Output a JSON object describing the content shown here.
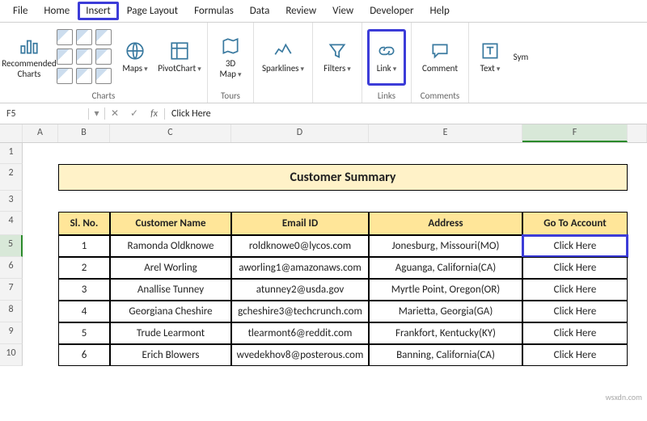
{
  "tabs": {
    "file": "File",
    "home": "Home",
    "insert": "Insert",
    "page_layout": "Page Layout",
    "formulas": "Formulas",
    "data": "Data",
    "review": "Review",
    "view": "View",
    "developer": "Developer",
    "help": "Help"
  },
  "ribbon": {
    "recommended_charts": "Recommended\nCharts",
    "charts_group": "Charts",
    "maps": "Maps",
    "pivotchart": "PivotChart",
    "threed_map": "3D\nMap",
    "tours_group": "Tours",
    "sparklines": "Sparklines",
    "filters": "Filters",
    "link": "Link",
    "links_group": "Links",
    "comment": "Comment",
    "comments_group": "Comments",
    "text": "Text",
    "sym": "Sym"
  },
  "formula_bar": {
    "name_box": "F5",
    "fx": "fx",
    "value": "Click Here"
  },
  "columns": {
    "A": "A",
    "B": "B",
    "C": "C",
    "D": "D",
    "E": "E",
    "F": "F"
  },
  "rows": {
    "r1": "1",
    "r2": "2",
    "r3": "3",
    "r4": "4",
    "r5": "5",
    "r6": "6",
    "r7": "7",
    "r8": "8",
    "r9": "9",
    "r10": "10"
  },
  "sheet": {
    "title": "Customer Summary",
    "headers": {
      "sl_no": "Sl. No.",
      "customer_name": "Customer Name",
      "email": "Email ID",
      "address": "Address",
      "go_to": "Go To Account"
    },
    "data": [
      {
        "no": "1",
        "name": "Ramonda Oldknowe",
        "email": "roldknowe0@lycos.com",
        "addr": "Jonesburg, Missouri(MO)",
        "link": "Click Here"
      },
      {
        "no": "2",
        "name": "Arel Worling",
        "email": "aworling1@amazonaws.com",
        "addr": "Aguanga, California(CA)",
        "link": "Click Here"
      },
      {
        "no": "3",
        "name": "Anallise Tunney",
        "email": "atunney2@usda.gov",
        "addr": "Myrtle Point, Oregon(OR)",
        "link": "Click Here"
      },
      {
        "no": "4",
        "name": "Georgiana Cheshire",
        "email": "gcheshire3@techcrunch.com",
        "addr": "Marietta, Georgia(GA)",
        "link": "Click Here"
      },
      {
        "no": "5",
        "name": "Trude Learmont",
        "email": "tlearmont6@reddit.com",
        "addr": "Frankfort, Kentucky(KY)",
        "link": "Click Here"
      },
      {
        "no": "6",
        "name": "Erich Blowers",
        "email": "wvedekhov8@posterous.com",
        "addr": "Banning, California(CA)",
        "link": "Click Here"
      }
    ]
  },
  "watermark": "wsxdn.com"
}
